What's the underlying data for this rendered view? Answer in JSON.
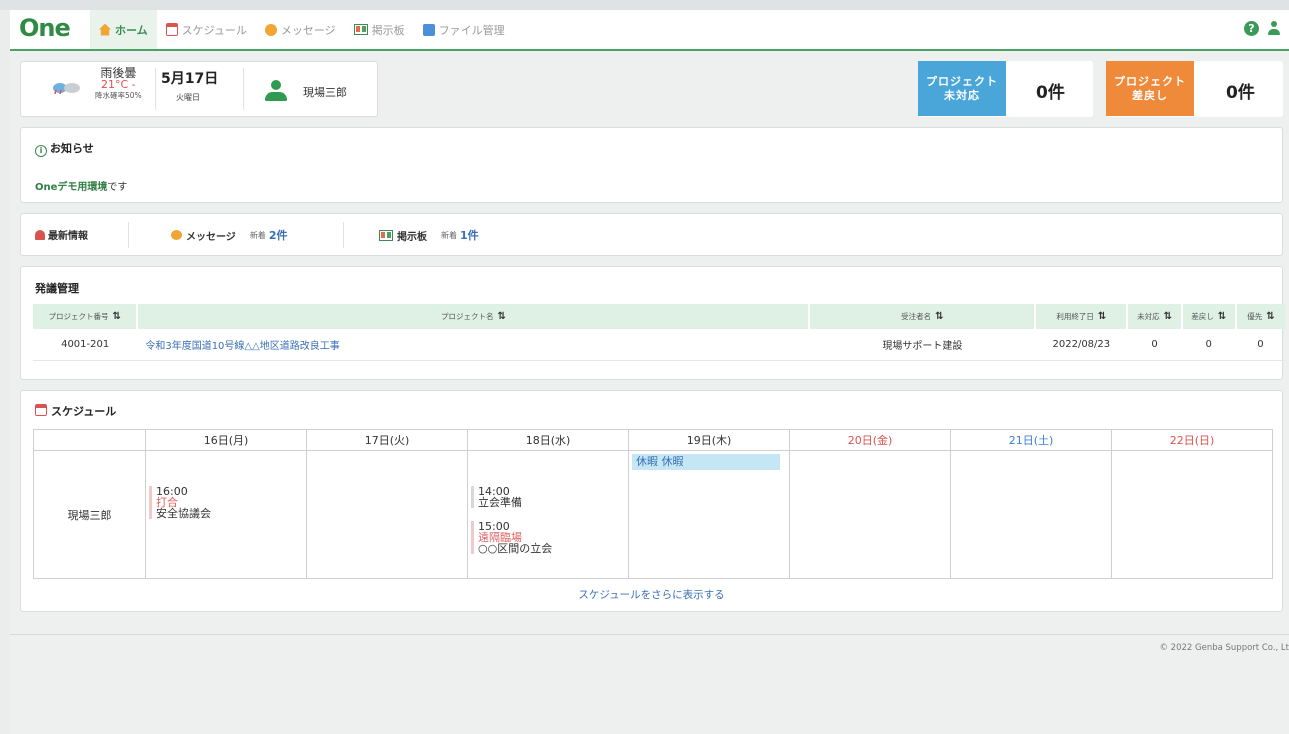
{
  "header": {
    "logo": "One",
    "nav": [
      {
        "label": "ホーム",
        "icon": "home-icon",
        "active": true
      },
      {
        "label": "スケジュール",
        "icon": "calendar-icon"
      },
      {
        "label": "メッセージ",
        "icon": "message-icon"
      },
      {
        "label": "掲示板",
        "icon": "board-icon"
      },
      {
        "label": "ファイル管理",
        "icon": "file-icon"
      }
    ],
    "help_label": "?"
  },
  "infobar": {
    "weather": {
      "condition": "雨後曇",
      "temp": "21°C -",
      "rain": "降水確率50%"
    },
    "date": {
      "main": "5月17日",
      "weekday": "火曜日"
    },
    "user_name": "現場三郎"
  },
  "kpis": [
    {
      "label_line1": "プロジェクト",
      "label_line2": "未対応",
      "value": "0件",
      "color": "#4aa5d8"
    },
    {
      "label_line1": "プロジェクト",
      "label_line2": "差戻し",
      "value": "0件",
      "color": "#ef8a3a"
    }
  ],
  "notice": {
    "title": "お知らせ",
    "text_highlight": "Oneデモ用環境",
    "text_rest": "です"
  },
  "updates": {
    "title": "最新情報",
    "message": {
      "label": "メッセージ",
      "new_label": "新着",
      "count": "2件"
    },
    "board": {
      "label": "掲示板",
      "new_label": "新着",
      "count": "1件"
    }
  },
  "orders": {
    "title": "発議管理",
    "columns": [
      "プロジェクト番号",
      "プロジェクト名",
      "受注者名",
      "利用終了日",
      "未対応",
      "差戻し",
      "優先"
    ],
    "sort_glyph": "⇅",
    "rows": [
      {
        "number": "4001-201",
        "name": "令和3年度国道10号線△△地区道路改良工事",
        "contractor": "現場サポート建設",
        "end_date": "2022/08/23",
        "pending": "0",
        "returned": "0",
        "priority": "0"
      }
    ]
  },
  "schedule": {
    "title": "スケジュール",
    "days": [
      "16日(月)",
      "17日(火)",
      "18日(水)",
      "19日(木)",
      "20日(金)",
      "21日(土)",
      "22日(日)"
    ],
    "person": "現場三郎",
    "events": {
      "mon": {
        "time": "16:00",
        "tag": "打合",
        "title": "安全協議会"
      },
      "wed1": {
        "time": "14:00",
        "title": "立会準備"
      },
      "wed2": {
        "time": "15:00",
        "tag": "遠隔臨場",
        "title": "○○区間の立会"
      },
      "thu": {
        "label": "休暇 休暇"
      }
    },
    "more_label": "スケジュールをさらに表示する"
  },
  "footer": {
    "copyright": "© 2022 Genba Support Co., Lt"
  }
}
